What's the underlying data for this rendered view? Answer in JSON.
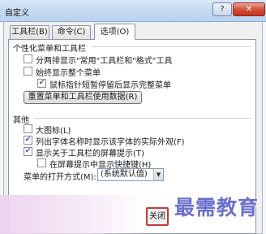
{
  "window": {
    "title": "自定义",
    "help_label": "?",
    "close_label": "✕"
  },
  "tabs": [
    {
      "label": "工具栏(B)"
    },
    {
      "label": "命令(C)"
    },
    {
      "label": "选项(O)"
    }
  ],
  "personalized": {
    "label": "个性化菜单和工具栏",
    "opt1": "分两排显示\"常用\"工具栏和\"格式\"工具",
    "opt2": "始终显示整个菜单",
    "opt3": "鼠标指针短暂停留后显示完整菜单",
    "reset_button": "重置菜单和工具栏使用数据(R)"
  },
  "other": {
    "label": "其他",
    "opt1": "大图标(L)",
    "opt2": "列出字体名称时显示该字体的实际外观(F)",
    "opt3": "显示关于工具栏的屏幕提示(T)",
    "opt4": "在屏幕提示中显示快捷键(H)",
    "animation_label": "菜单的打开方式(M):",
    "animation_value": "(系统默认值)"
  },
  "checked": {
    "personal1": false,
    "personal2": false,
    "personal3": true,
    "other1": false,
    "other2": true,
    "other3": true,
    "other4": false
  },
  "footer": {
    "close_button": "关闭"
  },
  "watermark": "最需教育"
}
